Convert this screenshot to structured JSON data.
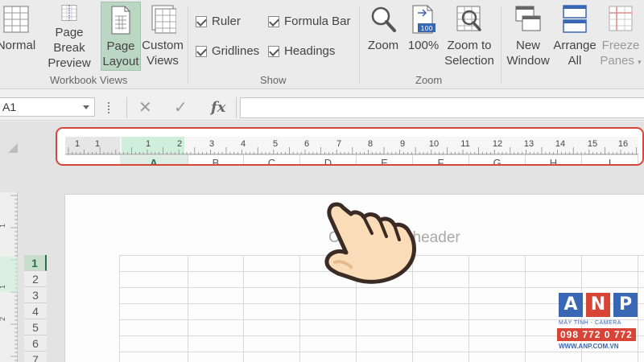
{
  "ribbon": {
    "workbook_views": {
      "group_label": "Workbook Views",
      "normal": "Normal",
      "page_break_1": "Page Break",
      "page_break_2": "Preview",
      "page_layout_1": "Page",
      "page_layout_2": "Layout",
      "custom_views_1": "Custom",
      "custom_views_2": "Views"
    },
    "show": {
      "group_label": "Show",
      "ruler": "Ruler",
      "formula_bar": "Formula Bar",
      "gridlines": "Gridlines",
      "headings": "Headings"
    },
    "zoom": {
      "group_label": "Zoom",
      "zoom": "Zoom",
      "hundred": "100%",
      "hundred_icon_text": "100",
      "zoom_sel_1": "Zoom to",
      "zoom_sel_2": "Selection"
    },
    "window": {
      "new_window_1": "New",
      "new_window_2": "Window",
      "arrange_1": "Arrange",
      "arrange_2": "All",
      "freeze_1": "Freeze",
      "freeze_2": "Panes"
    }
  },
  "formula_bar": {
    "name_box": "A1",
    "cancel_icon": "✕",
    "enter_icon": "✓",
    "fx": "fx",
    "formula_value": ""
  },
  "ruler": {
    "labels": [
      "1",
      "1",
      "1",
      "2",
      "3",
      "4",
      "5",
      "6",
      "7",
      "8",
      "9",
      "10",
      "11",
      "12",
      "13",
      "14",
      "15",
      "16"
    ]
  },
  "columns": [
    "A",
    "B",
    "C",
    "D",
    "E",
    "F",
    "G",
    "H",
    "I"
  ],
  "rows": [
    "1",
    "2",
    "3",
    "4",
    "5",
    "6",
    "7"
  ],
  "vruler_labels": [
    "1",
    "1",
    "2"
  ],
  "page": {
    "header_placeholder": "Click to add header"
  },
  "watermark": {
    "letters": [
      "A",
      "N",
      "P"
    ],
    "tagline": "MÁY TÍNH - CAMERA",
    "phone": "098 772 0 772",
    "site": "WWW.ANP.COM.VN"
  },
  "colors": {
    "excel_green": "#217346",
    "highlight_red": "#d7463a",
    "logo_blue": "#3a67b4",
    "logo_red": "#d84436"
  }
}
